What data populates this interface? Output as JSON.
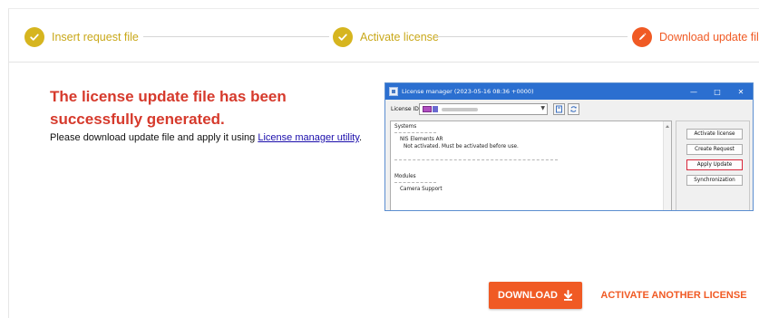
{
  "stepper": {
    "steps": [
      {
        "label": "Insert request file",
        "state": "done"
      },
      {
        "label": "Activate license",
        "state": "done"
      },
      {
        "label": "Download update file",
        "state": "active"
      }
    ]
  },
  "message": {
    "title": "The license update file has been successfully generated.",
    "instructions_prefix": "Please download update file and apply it using ",
    "link_text": "License manager utility",
    "instructions_suffix": "."
  },
  "license_manager_screenshot": {
    "window_title": "License manager (2023-05-16 08:36 +0000)",
    "license_id_label": "License ID:",
    "systems_header": "Systems",
    "system_name": "NIS Elements AR",
    "system_status": "Not activated. Must be activated before use.",
    "modules_header": "Modules",
    "module_name": "Camera Support",
    "buttons": {
      "activate": "Activate license",
      "create": "Create Request",
      "apply": "Apply Update",
      "sync": "Synchronization"
    }
  },
  "actions": {
    "download": "DOWNLOAD",
    "activate_another": "ACTIVATE ANOTHER LICENSE"
  },
  "colors": {
    "accent": "#f05a24",
    "done": "#d6b51f",
    "title_red": "#d63a2c",
    "highlight": "#d8263a"
  },
  "icons": {
    "done_step": "check-icon",
    "active_step": "pencil-icon",
    "download": "download-icon"
  }
}
